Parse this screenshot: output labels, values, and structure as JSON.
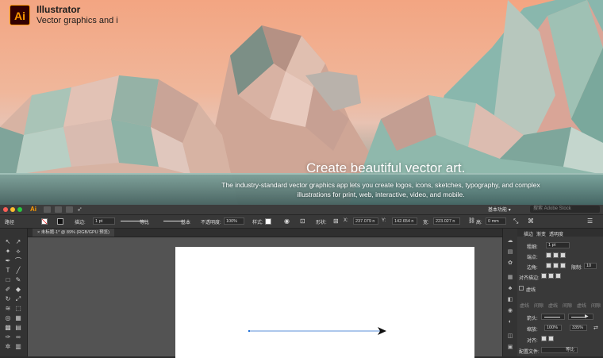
{
  "hero": {
    "app_logo": "Ai",
    "app_name": "Illustrator",
    "app_subtitle": "Vector graphics and i",
    "headline": "Create beautiful vector art.",
    "description": "The industry-standard vector graphics app lets you create logos, icons, sketches, typography, and complex illustrations for print, web, interactive, video, and mobile."
  },
  "menubar": {
    "logo": "Ai",
    "workspace": "基本功能",
    "workspace_arrow": "▾",
    "search_placeholder": "搜索 Adobe Stock"
  },
  "control_bar": {
    "path_label": "路径",
    "stroke_label": "描边:",
    "stroke_weight": "1 pt",
    "profile_label": "等比",
    "brush_label": "基本",
    "opacity_label": "不透明度:",
    "opacity_value": "100%",
    "style_label": "样式:",
    "shape_label": "形状:",
    "x_label": "X:",
    "x_value": "237.079 n",
    "y_label": "Y:",
    "y_value": "142.654 n",
    "w_label": "宽:",
    "w_value": "223.027 n",
    "h_label": "高:",
    "h_value": "0 mm"
  },
  "document": {
    "tab_label": "未标题-1* @ 89% (RGB/GPU 预览)"
  },
  "stroke_panel": {
    "tabs": [
      "描边",
      "渐变",
      "透明度"
    ],
    "weight_label": "粗细:",
    "weight_value": "1 pt",
    "cap_label": "端点:",
    "corner_label": "边角:",
    "limit_label": "限制:",
    "limit_value": "10",
    "align_label": "对齐描边:",
    "dashed_label": "虚线",
    "dash_cells": [
      "虚线",
      "间隙",
      "虚线",
      "间隙",
      "虚线",
      "间隙"
    ],
    "arrowheads_label": "箭头:",
    "scale_label": "缩放:",
    "scale_start": "100%",
    "scale_end": "335%",
    "align_arrow_label": "对齐:",
    "profile_label": "配置文件:",
    "profile_value": "等比"
  },
  "colors": {
    "accent_orange": "#ff9a00",
    "selection_blue": "#1e6fd6"
  }
}
